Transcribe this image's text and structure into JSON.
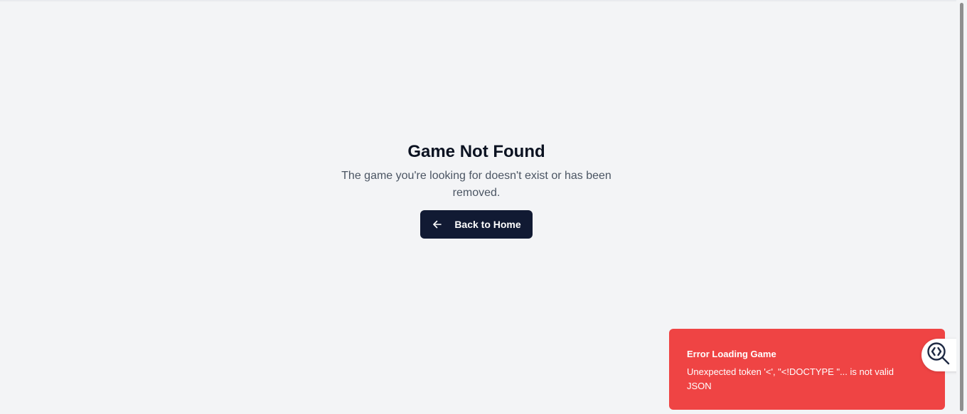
{
  "main": {
    "title": "Game Not Found",
    "description": "The game you're looking for doesn't exist or has been removed.",
    "back_button_label": "Back to Home",
    "back_button_icon": "arrow-left-icon"
  },
  "toast": {
    "title": "Error Loading Game",
    "message": "Unexpected token '<', \"<!DOCTYPE \"... is not valid JSON",
    "color": "#ef4444"
  },
  "devtool": {
    "icon": "code-search-icon"
  },
  "colors": {
    "background": "#f3f4f6",
    "button": "#111a33",
    "title": "#0b1221",
    "description": "#4b5563"
  }
}
